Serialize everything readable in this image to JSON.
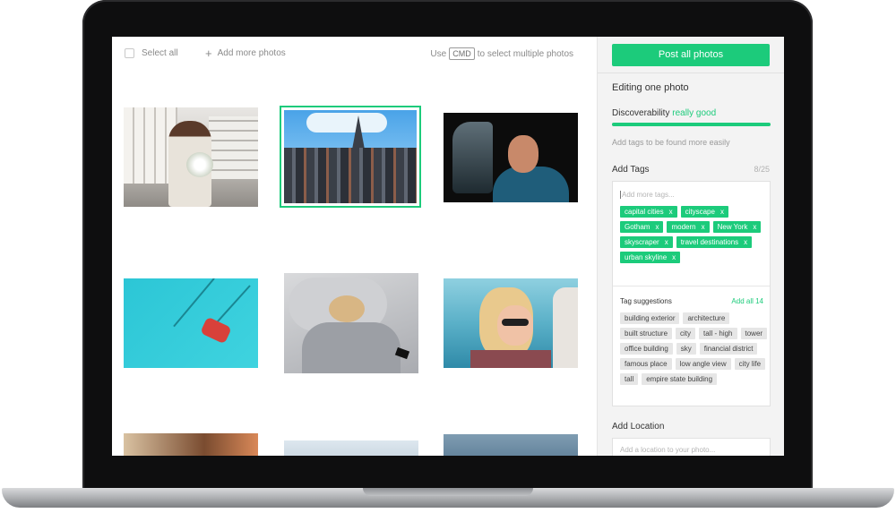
{
  "toolbar": {
    "select_all": "Select all",
    "add_more": "Add more photos",
    "cmd_prefix": "Use",
    "cmd_key": "CMD",
    "cmd_suffix": "to select multiple photos"
  },
  "panel": {
    "post_button": "Post all photos",
    "editing_title": "Editing one photo",
    "discoverability_label": "Discoverability",
    "discoverability_value": "really good",
    "discoverability_progress": 1.0,
    "discoverability_hint": "Add tags to be found more easily",
    "add_tags_label": "Add Tags",
    "tag_count": "8/25",
    "tags_placeholder": "Add more tags...",
    "tags": [
      "capital cities",
      "cityscape",
      "Gotham",
      "modern",
      "New York",
      "skyscraper",
      "travel destinations",
      "urban skyline"
    ],
    "suggestions_label": "Tag suggestions",
    "suggestions_add_all": "Add all 14",
    "suggestions": [
      "building exterior",
      "architecture",
      "built structure",
      "city",
      "tall - high",
      "tower",
      "office building",
      "sky",
      "financial district",
      "famous place",
      "low angle view",
      "city life",
      "tall",
      "empire state building"
    ],
    "location_label": "Add Location",
    "location_placeholder": "Add a location to your photo...",
    "chip_remove": "x"
  },
  "colors": {
    "accent": "#1ccb7b",
    "panel_bg": "#f3f3f3",
    "laptop_frame": "#0e0e0f"
  }
}
